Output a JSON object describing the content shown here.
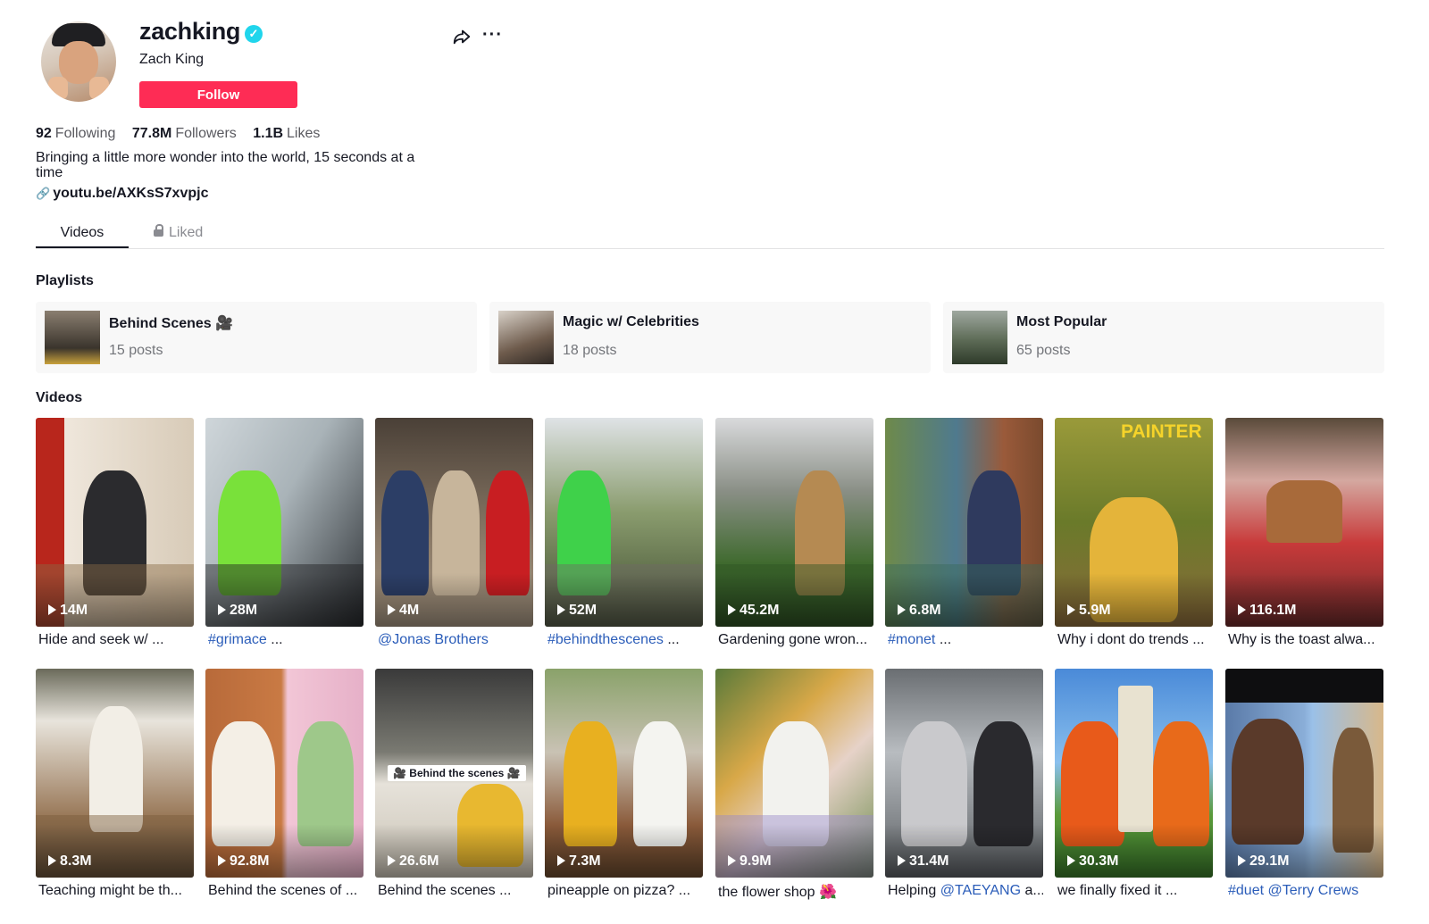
{
  "profile": {
    "username": "zachking",
    "nickname": "Zach King",
    "follow_label": "Follow",
    "following_count": "92",
    "following_label": "Following",
    "followers_count": "77.8M",
    "followers_label": "Followers",
    "likes_count": "1.1B",
    "likes_label": "Likes",
    "bio": "Bringing a little more wonder into the world, 15 seconds at a time",
    "link": "youtu.be/AXKsS7xvpjc"
  },
  "tabs": {
    "videos": "Videos",
    "liked": "Liked"
  },
  "sections": {
    "playlists": "Playlists",
    "videos": "Videos"
  },
  "playlists": [
    {
      "name": "Behind Scenes 🎥",
      "count": "15 posts"
    },
    {
      "name": "Magic w/ Celebrities",
      "count": "18 posts"
    },
    {
      "name": "Most Popular",
      "count": "65 posts"
    }
  ],
  "videos": [
    {
      "views": "14M",
      "caption": "Hide and seek w/ ...",
      "tag": ""
    },
    {
      "views": "28M",
      "caption": " ...",
      "tag": "#grimace"
    },
    {
      "views": "4M",
      "caption": "",
      "tag": "@Jonas Brothers"
    },
    {
      "views": "52M",
      "caption": " ...",
      "tag": "#behindthescenes"
    },
    {
      "views": "45.2M",
      "caption": "Gardening gone wron...",
      "tag": ""
    },
    {
      "views": "6.8M",
      "caption": " ...",
      "tag": "#monet"
    },
    {
      "views": "5.9M",
      "caption": "Why i dont do trends ...",
      "tag": ""
    },
    {
      "views": "116.1M",
      "caption": "Why is the toast alwa...",
      "tag": ""
    },
    {
      "views": "8.3M",
      "caption": "Teaching might be th...",
      "tag": ""
    },
    {
      "views": "92.8M",
      "caption": "Behind the scenes of ...",
      "tag": ""
    },
    {
      "views": "26.6M",
      "caption": "Behind the scenes ...",
      "tag": ""
    },
    {
      "views": "7.3M",
      "caption": "pineapple on pizza? ...",
      "tag": ""
    },
    {
      "views": "9.9M",
      "caption": "the flower shop 🌺",
      "tag": ""
    },
    {
      "views": "31.4M",
      "caption": "Helping ",
      "tag": "@TAEYANG",
      "after": " a..."
    },
    {
      "views": "30.3M",
      "caption": "we finally fixed it ...",
      "tag": ""
    },
    {
      "views": "29.1M",
      "caption": "",
      "tag": "#duet @Terry Crews"
    }
  ],
  "thumb_overlays": {
    "painter": "PAINTER",
    "bts_badge": "🎥 Behind the scenes 🎥"
  },
  "colors": {
    "accent": "#fe2c55",
    "tag": "#2b5db9",
    "verified": "#20d5ec"
  }
}
